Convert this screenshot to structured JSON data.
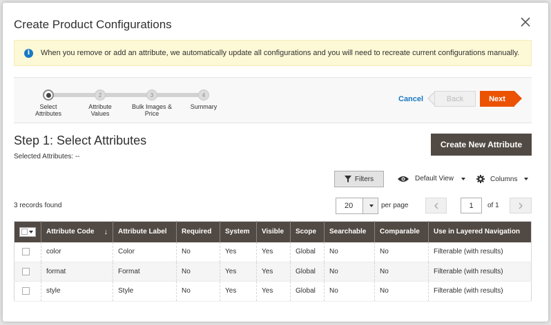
{
  "modal": {
    "title": "Create Product Configurations",
    "close_icon": "close-icon"
  },
  "notice": {
    "text": "When you remove or add an attribute, we automatically update all configurations and you will need to recreate current configurations manually.",
    "icon": "info-icon",
    "color": "#fdf8d6"
  },
  "wizard": {
    "steps": [
      {
        "number": "",
        "label_line1": "Select",
        "label_line2": "Attributes",
        "active": true
      },
      {
        "number": "2",
        "label_line1": "Attribute",
        "label_line2": "Values",
        "active": false
      },
      {
        "number": "3",
        "label_line1": "Bulk Images &",
        "label_line2": "Price",
        "active": false
      },
      {
        "number": "4",
        "label_line1": "Summary",
        "label_line2": "",
        "active": false
      }
    ],
    "cancel_label": "Cancel",
    "back_label": "Back",
    "next_label": "Next",
    "next_color": "#eb5202"
  },
  "step": {
    "heading": "Step 1: Select Attributes",
    "selected_label": "Selected Attributes: --",
    "create_button": "Create New Attribute"
  },
  "toolbar": {
    "filters_label": "Filters",
    "view_label": "Default View",
    "columns_label": "Columns",
    "records_found": "3 records found",
    "per_page_value": "20",
    "per_page_label": "per page",
    "page_value": "1",
    "page_of": "of 1"
  },
  "grid": {
    "columns": [
      "Attribute Code",
      "Attribute Label",
      "Required",
      "System",
      "Visible",
      "Scope",
      "Searchable",
      "Comparable",
      "Use in Layered Navigation"
    ],
    "sort_arrow": "↓",
    "rows": [
      [
        "color",
        "Color",
        "No",
        "Yes",
        "Yes",
        "Global",
        "No",
        "No",
        "Filterable (with results)"
      ],
      [
        "format",
        "Format",
        "No",
        "Yes",
        "Yes",
        "Global",
        "No",
        "No",
        "Filterable (with results)"
      ],
      [
        "style",
        "Style",
        "No",
        "Yes",
        "Yes",
        "Global",
        "No",
        "No",
        "Filterable (with results)"
      ]
    ],
    "header_color": "#514943"
  }
}
